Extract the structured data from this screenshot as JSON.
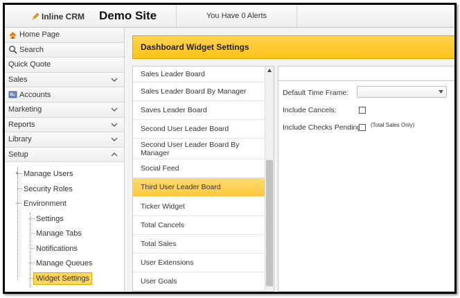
{
  "header": {
    "app_name": "Inline CRM",
    "site_title": "Demo Site",
    "alerts_text": "You Have 0 Alerts"
  },
  "sidebar": {
    "items": [
      {
        "label": "Home Page",
        "icon": "home-icon"
      },
      {
        "label": "Search",
        "icon": "search-icon"
      },
      {
        "label": "Quick Quote"
      },
      {
        "label": "Sales",
        "chevron": "down"
      },
      {
        "label": "Accounts",
        "icon": "accounts-icon"
      },
      {
        "label": "Marketing",
        "chevron": "down"
      },
      {
        "label": "Reports",
        "chevron": "down"
      },
      {
        "label": "Library",
        "chevron": "down"
      },
      {
        "label": "Setup",
        "chevron": "up"
      }
    ],
    "tree": {
      "manage_users": "Manage Users",
      "security_roles": "Security Roles",
      "environment": "Environment",
      "settings": "Settings",
      "manage_tabs": "Manage Tabs",
      "notifications": "Notifications",
      "manage_queues": "Manage Queues",
      "widget_settings": "Widget Settings"
    }
  },
  "main": {
    "panel_title": "Dashboard Widget Settings",
    "widgets": [
      "Sales Leader Board",
      "Sales Leader Board By Manager",
      "Saves Leader Board",
      "Second User Leader Board",
      "Second User Leader Board By Manager",
      "Social Feed",
      "Third User Leader Board",
      "Ticker Widget",
      "Total Cancels",
      "Total Sales",
      "User Extensions",
      "User Goals"
    ],
    "selected_widget": "Third User Leader Board",
    "settings": {
      "default_time_frame_label": "Default Time Frame:",
      "default_time_frame_value": "",
      "include_cancels_label": "Include Cancels:",
      "include_checks_pending_label": "Include Checks Pending:",
      "total_sales_only_note": "(Total Sales Only)"
    }
  },
  "colors": {
    "accent_yellow": "#ffc21a",
    "selection_yellow": "#ffd75a"
  }
}
